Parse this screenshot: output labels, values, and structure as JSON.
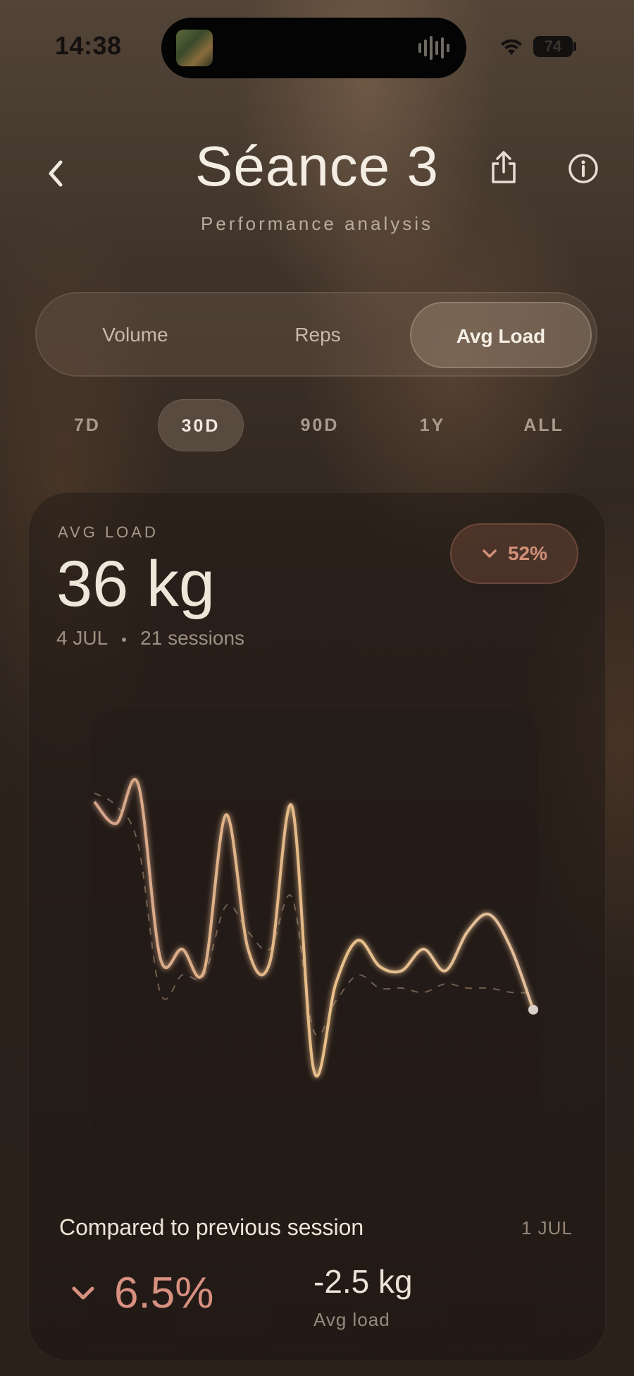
{
  "status_bar": {
    "time": "14:38",
    "battery": "74",
    "icons": [
      "album-art-icon",
      "audio-wave-icon",
      "wifi-icon",
      "battery-icon"
    ]
  },
  "header": {
    "title": "Séance 3",
    "subtitle": "Performance analysis",
    "icons": [
      "chevron-left-icon",
      "share-icon",
      "info-icon"
    ]
  },
  "metric_tabs": {
    "items": [
      {
        "label": "Volume",
        "active": false
      },
      {
        "label": "Reps",
        "active": false
      },
      {
        "label": "Avg Load",
        "active": true
      }
    ]
  },
  "range_tabs": {
    "items": [
      {
        "label": "7D",
        "active": false
      },
      {
        "label": "30D",
        "active": true
      },
      {
        "label": "90D",
        "active": false
      },
      {
        "label": "1Y",
        "active": false
      },
      {
        "label": "ALL",
        "active": false
      }
    ]
  },
  "summary": {
    "label": "AVG LOAD",
    "value": "36 kg",
    "date": "4 JUL",
    "sessions": "21 sessions",
    "change": "52%",
    "change_direction": "down"
  },
  "chart_data": {
    "type": "line",
    "title": "",
    "xlabel": "",
    "ylabel": "",
    "grid": false,
    "legend": "none",
    "x": [
      1,
      2,
      3,
      4,
      5,
      6,
      7,
      8,
      9,
      10,
      11,
      12,
      13,
      14,
      15,
      16,
      17,
      18,
      19,
      20,
      21
    ],
    "series": [
      {
        "values": [
          84,
          79,
          88,
          48,
          50,
          45,
          81,
          50,
          47,
          83,
          22,
          42,
          52,
          46,
          45,
          50,
          45,
          54,
          58,
          50,
          36
        ],
        "color": "#e2b68c"
      },
      {
        "values": [
          86,
          83,
          74,
          40,
          44,
          44,
          60,
          54,
          50,
          62,
          31,
          38,
          44,
          41,
          41,
          40,
          42,
          41,
          41,
          40,
          40
        ],
        "color": "#8a7562",
        "dashed": true
      }
    ]
  },
  "comparison": {
    "label": "Compared to previous session",
    "date": "1 JUL",
    "percent": "6.5%",
    "direction": "down",
    "delta": "-2.5 kg",
    "delta_label": "Avg load"
  },
  "colors": {
    "accent": "#e2b68c",
    "negative": "#d89080",
    "text": "#efe6da"
  }
}
